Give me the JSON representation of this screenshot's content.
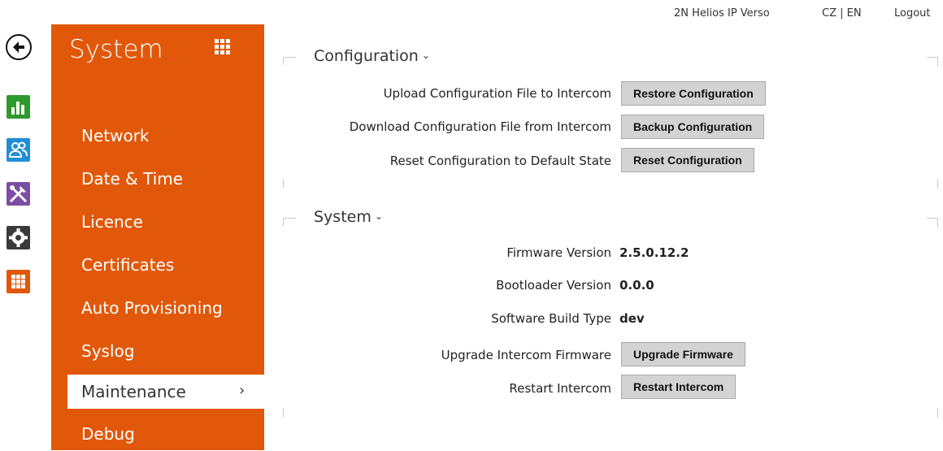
{
  "topbar": {
    "device": "2N Helios IP Verso",
    "lang": "CZ | EN",
    "logout": "Logout"
  },
  "rail": {
    "icons": [
      {
        "name": "back-arrow-icon"
      },
      {
        "name": "status-chart-icon",
        "color": "#2d9a2d"
      },
      {
        "name": "directory-users-icon",
        "color": "#1f8fd6"
      },
      {
        "name": "hardware-tools-icon",
        "color": "#7b4ea3"
      },
      {
        "name": "services-gear-icon",
        "color": "#3a3a3a"
      },
      {
        "name": "system-grid-icon",
        "color": "#e1580a"
      }
    ]
  },
  "sidebar": {
    "title": "System",
    "color": "#e1580a",
    "items": [
      {
        "label": "Network"
      },
      {
        "label": "Date & Time"
      },
      {
        "label": "Licence"
      },
      {
        "label": "Certificates"
      },
      {
        "label": "Auto Provisioning"
      },
      {
        "label": "Syslog"
      },
      {
        "label": "Maintenance",
        "chevron": "›"
      },
      {
        "label": "Debug"
      }
    ]
  },
  "configuration": {
    "title": "Configuration",
    "rows": [
      {
        "label": "Upload Configuration File to Intercom",
        "button": "Restore Configuration"
      },
      {
        "label": "Download Configuration File from Intercom",
        "button": "Backup Configuration"
      },
      {
        "label": "Reset Configuration to Default State",
        "button": "Reset Configuration"
      }
    ]
  },
  "system": {
    "title": "System",
    "firmware_label": "Firmware Version",
    "firmware_value": "2.5.0.12.2",
    "bootloader_label": "Bootloader Version",
    "bootloader_value": "0.0.0",
    "build_label": "Software Build Type",
    "build_value": "dev",
    "upgrade_label": "Upgrade Intercom Firmware",
    "upgrade_button": "Upgrade Firmware",
    "restart_label": "Restart Intercom",
    "restart_button": "Restart Intercom"
  }
}
